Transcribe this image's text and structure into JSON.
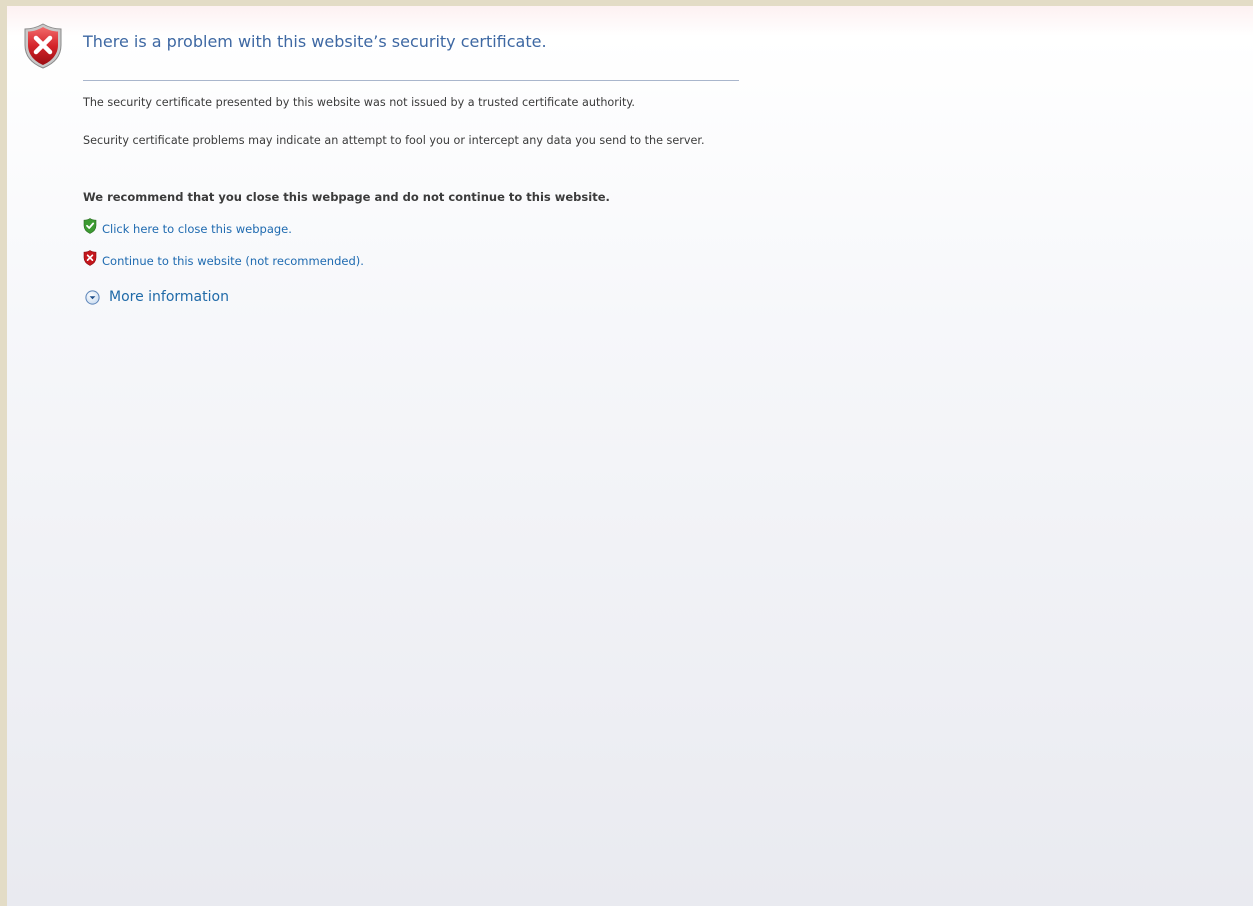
{
  "error": {
    "icon": "error-shield-icon",
    "title": "There is a problem with this website’s security certificate.",
    "paragraph_1": "The security certificate presented by this website was not issued by a trusted certificate authority.",
    "paragraph_2": "Security certificate problems may indicate an attempt to fool you or intercept any data you send to the server.",
    "recommendation": "We recommend that you close this webpage and do not continue to this website."
  },
  "actions": {
    "close_link": "Click here to close this webpage.",
    "close_icon": "green-shield-check-icon",
    "continue_link": "Continue to this website (not recommended).",
    "continue_icon": "red-shield-x-icon",
    "more_info": "More information",
    "more_info_icon": "expand-circle-chevron-down-icon"
  },
  "colors": {
    "title": "#3e68a3",
    "link": "#1e6ab0",
    "text": "#3b3b3b",
    "error_red": "#c4161c",
    "ok_green": "#3c9a32"
  }
}
